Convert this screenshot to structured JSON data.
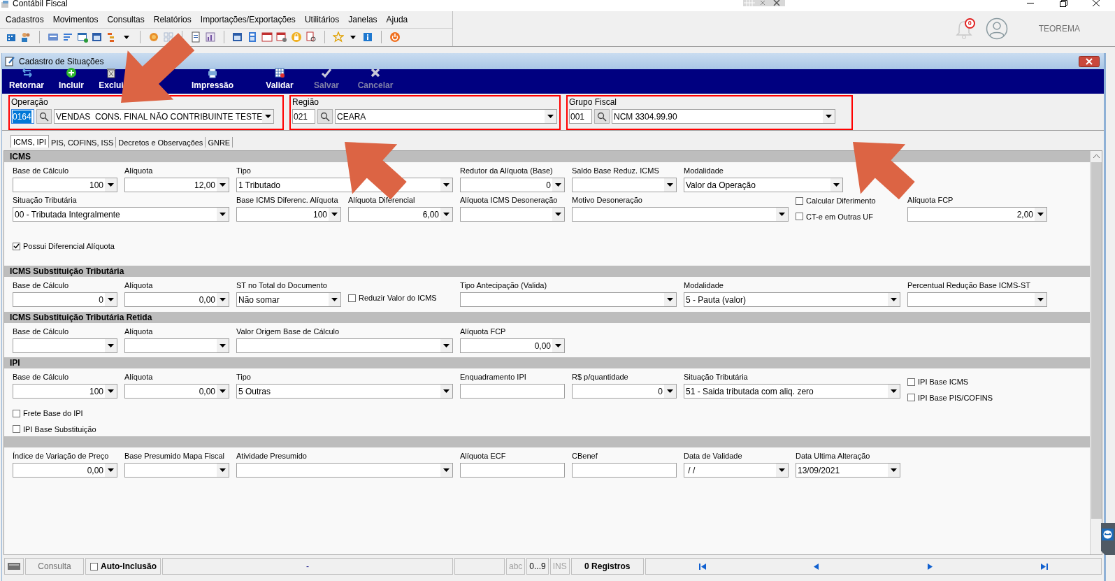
{
  "window": {
    "title": "Contábil Fiscal"
  },
  "menu": [
    "Cadastros",
    "Movimentos",
    "Consultas",
    "Relatórios",
    "Importações/Exportações",
    "Utilitários",
    "Janelas",
    "Ajuda"
  ],
  "user_area": {
    "notifications": "0",
    "user": "TEOREMA"
  },
  "child_window": {
    "title": "Cadastro de Situações"
  },
  "actions": [
    {
      "label": "Retornar",
      "disabled": false
    },
    {
      "label": "Incluir",
      "disabled": false
    },
    {
      "label": "Exclui",
      "disabled": false
    },
    {
      "label": "Impressão",
      "disabled": false
    },
    {
      "label": "Validar",
      "disabled": false
    },
    {
      "label": "Salvar",
      "disabled": true
    },
    {
      "label": "Cancelar",
      "disabled": true
    }
  ],
  "header": [
    {
      "label": "Operação",
      "code": "0164",
      "code_selected": true,
      "value": "VENDAS  CONS. FINAL NÃO CONTRIBUINTE TESTE"
    },
    {
      "label": "Região",
      "code": "021",
      "code_selected": false,
      "value": "CEARA"
    },
    {
      "label": "Grupo Fiscal",
      "code": "001",
      "code_selected": false,
      "value": "NCM 3304.99.90"
    }
  ],
  "tabs": [
    {
      "label": "ICMS, IPI",
      "selected": true
    },
    {
      "label": "PIS, COFINS, ISS",
      "selected": false
    },
    {
      "label": "Decretos e Observações",
      "selected": false
    },
    {
      "label": "GNRE",
      "selected": false
    }
  ],
  "sections": [
    {
      "title": "ICMS",
      "fields": [
        {
          "kind": "number",
          "label": "Base de Cálculo",
          "value": "100"
        },
        {
          "kind": "number",
          "label": "Alíquota",
          "value": "12,00"
        },
        {
          "kind": "combo",
          "label": "Tipo",
          "value": "1 Tributado"
        },
        {
          "kind": "number",
          "label": "Redutor da Alíquota (Base)",
          "value": "0"
        },
        {
          "kind": "number",
          "label": "Saldo Base Reduz. ICMS"
        },
        {
          "kind": "combo",
          "label": "Modalidade",
          "value": "Valor da Operação"
        },
        {
          "kind": "combo",
          "label": "Situação Tributária",
          "value": "00 - Tributada Integralmente"
        },
        {
          "kind": "number",
          "label": "Base ICMS Diferenc. Alíquota",
          "value": "100"
        },
        {
          "kind": "number",
          "label": "Alíquota Diferencial",
          "value": "6,00"
        },
        {
          "kind": "number",
          "label": "Alíquota ICMS Desoneração"
        },
        {
          "kind": "combo",
          "label": "Motivo Desoneração"
        },
        {
          "kind": "checks",
          "items": [
            {
              "label": "Calcular Diferimento",
              "checked": false
            },
            {
              "label": "CT-e em Outras UF",
              "checked": false
            }
          ]
        },
        {
          "kind": "number",
          "label": "Alíquota FCP",
          "value": "2,00"
        },
        {
          "kind": "checks",
          "items": [
            {
              "label": "Possui Diferencial Alíquota",
              "checked": true
            }
          ]
        }
      ]
    },
    {
      "title": "ICMS Substituição Tributária",
      "fields": [
        {
          "kind": "number",
          "label": "Base de Cálculo",
          "value": "0"
        },
        {
          "kind": "number",
          "label": "Alíquota",
          "value": "0,00"
        },
        {
          "kind": "combo",
          "label": "ST no Total do Documento",
          "value": "Não somar"
        },
        {
          "kind": "checks",
          "items": [
            {
              "label": "Reduzir Valor do ICMS",
              "checked": false
            }
          ]
        },
        {
          "kind": "combo",
          "label": "Tipo Antecipação (Valida)"
        },
        {
          "kind": "combo",
          "label": "Modalidade",
          "value": "5 - Pauta (valor)"
        },
        {
          "kind": "combo",
          "label": "Percentual Redução Base ICMS-ST"
        }
      ]
    },
    {
      "title": "ICMS Substituição Tributária Retida",
      "fields": [
        {
          "kind": "number",
          "label": "Base de Cálculo"
        },
        {
          "kind": "number",
          "label": "Alíquota"
        },
        {
          "kind": "combo",
          "label": "Valor Origem Base de Cálculo"
        },
        {
          "kind": "number",
          "label": "Alíquota FCP",
          "value": "0,00"
        }
      ]
    },
    {
      "title": "IPI",
      "fields": [
        {
          "kind": "number",
          "label": "Base de Cálculo",
          "value": "100"
        },
        {
          "kind": "number",
          "label": "Alíquota",
          "value": "0,00"
        },
        {
          "kind": "combo",
          "label": "Tipo",
          "value": "5 Outras"
        },
        {
          "kind": "text",
          "label": "Enquadramento IPI"
        },
        {
          "kind": "number",
          "label": "R$ p/quantidade",
          "value": "0"
        },
        {
          "kind": "combo",
          "label": "Situação Tributária",
          "value": "51 - Saida tributada com aliq. zero"
        },
        {
          "kind": "checks",
          "items": [
            {
              "label": "IPI Base ICMS",
              "checked": false
            },
            {
              "label": "IPI Base PIS/COFINS",
              "checked": false
            }
          ]
        },
        {
          "kind": "checks",
          "items": [
            {
              "label": "Frete Base do IPI",
              "checked": false
            },
            {
              "label": "IPI Base Substituição",
              "checked": false
            }
          ]
        }
      ]
    },
    {
      "fields": [
        {
          "kind": "number",
          "label": "Índice de Variação de Preço",
          "value": "0,00"
        },
        {
          "kind": "combo",
          "label": "Base Presumido Mapa Fiscal"
        },
        {
          "kind": "combo",
          "label": "Atividade Presumido"
        },
        {
          "kind": "text",
          "label": "Alíquota ECF"
        },
        {
          "kind": "text",
          "label": "CBenef"
        },
        {
          "kind": "combo",
          "label": "Data de Validade",
          "value": " / /"
        },
        {
          "kind": "combo",
          "label": "Data Ultima Alteração",
          "value": "13/09/2021"
        }
      ]
    }
  ],
  "status_bar": {
    "mode": "Consulta",
    "auto_inclusion": {
      "label": "Auto-Inclusão",
      "checked": false
    },
    "message": "-",
    "indicators": [
      {
        "label": "abc",
        "on": false
      },
      {
        "label": "0...9",
        "on": true
      },
      {
        "label": "INS",
        "on": false
      }
    ],
    "records": "0 Registros"
  }
}
